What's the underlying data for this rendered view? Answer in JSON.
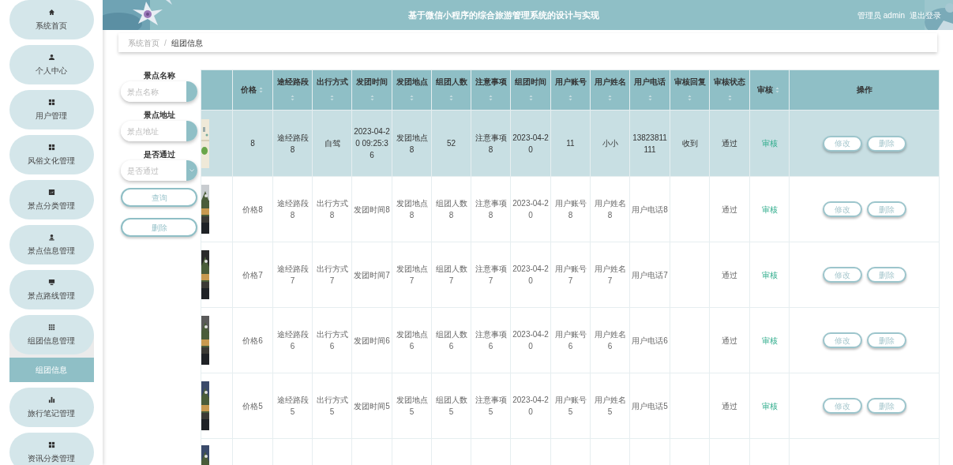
{
  "sidebar": {
    "items": [
      {
        "label": "系统首页",
        "expanded": false
      },
      {
        "label": "个人中心",
        "expanded": false
      },
      {
        "label": "用户管理",
        "expanded": false
      },
      {
        "label": "风俗文化管理",
        "expanded": false
      },
      {
        "label": "景点分类管理",
        "expanded": false
      },
      {
        "label": "景点信息管理",
        "expanded": false
      },
      {
        "label": "景点路线管理",
        "expanded": false
      },
      {
        "label": "组团信息管理",
        "expanded": true,
        "children": [
          {
            "label": "组团信息",
            "selected": true
          }
        ]
      },
      {
        "label": "旅行笔记管理",
        "expanded": false
      },
      {
        "label": "资讯分类管理",
        "expanded": false
      }
    ]
  },
  "header": {
    "title": "基于微信小程序的综合旅游管理系统的设计与实现",
    "user": "管理员 admin",
    "logout": "退出登录"
  },
  "breadcrumb": {
    "items": [
      "系统首页",
      "组团信息"
    ],
    "separator": "/"
  },
  "filters": [
    {
      "kind": "input",
      "label": "景点名称",
      "placeholder": "景点名称"
    },
    {
      "kind": "input",
      "label": "景点地址",
      "placeholder": "景点地址"
    },
    {
      "kind": "select",
      "label": "是否通过",
      "placeholder": "是否通过"
    }
  ],
  "filter_buttons": [
    "查询",
    "删除"
  ],
  "table": {
    "columns": [
      {
        "label": "价格",
        "sortable": true
      },
      {
        "label": "途经路段",
        "sortable": true
      },
      {
        "label": "出行方式",
        "sortable": true
      },
      {
        "label": "发团时间",
        "sortable": true
      },
      {
        "label": "发团地点",
        "sortable": true
      },
      {
        "label": "组团人数",
        "sortable": true
      },
      {
        "label": "注意事项",
        "sortable": true
      },
      {
        "label": "组团时间",
        "sortable": true
      },
      {
        "label": "用户账号",
        "sortable": true
      },
      {
        "label": "用户姓名",
        "sortable": true
      },
      {
        "label": "用户电话",
        "sortable": true
      },
      {
        "label": "审核回复",
        "sortable": true
      },
      {
        "label": "审核状态",
        "sortable": true
      },
      {
        "label": "审核",
        "sortable": true
      },
      {
        "label": "操作",
        "sortable": false
      }
    ],
    "rows": [
      {
        "selected": true,
        "cells": [
          "8",
          "途经路段8",
          "自驾",
          "2023-04-20 09:25:36",
          "发团地点8",
          "52",
          "注意事项8",
          "2023-04-20",
          "11",
          "小小",
          "13823811111",
          "收到",
          "通过"
        ],
        "review": "审核",
        "actions": [
          "修改",
          "删除"
        ]
      },
      {
        "selected": false,
        "cells": [
          "价格8",
          "途经路段8",
          "出行方式8",
          "发团时间8",
          "发团地点8",
          "组团人数8",
          "注意事项8",
          "2023-04-20",
          "用户账号8",
          "用户姓名8",
          "用户电话8",
          null,
          "通过"
        ],
        "review": "审核",
        "actions": [
          "修改",
          "删除"
        ]
      },
      {
        "selected": false,
        "cells": [
          "价格7",
          "途经路段7",
          "出行方式7",
          "发团时间7",
          "发团地点7",
          "组团人数7",
          "注意事项7",
          "2023-04-20",
          "用户账号7",
          "用户姓名7",
          "用户电话7",
          null,
          "通过"
        ],
        "review": "审核",
        "actions": [
          "修改",
          "删除"
        ]
      },
      {
        "selected": false,
        "cells": [
          "价格6",
          "途经路段6",
          "出行方式6",
          "发团时间6",
          "发团地点6",
          "组团人数6",
          "注意事项6",
          "2023-04-20",
          "用户账号6",
          "用户姓名6",
          "用户电话6",
          null,
          "通过"
        ],
        "review": "审核",
        "actions": [
          "修改",
          "删除"
        ]
      },
      {
        "selected": false,
        "cells": [
          "价格5",
          "途经路段5",
          "出行方式5",
          "发团时间5",
          "发团地点5",
          "组团人数5",
          "注意事项5",
          "2023-04-20",
          "用户账号5",
          "用户姓名5",
          "用户电话5",
          null,
          "通过"
        ],
        "review": "审核",
        "actions": [
          "修改",
          "删除"
        ]
      }
    ]
  }
}
